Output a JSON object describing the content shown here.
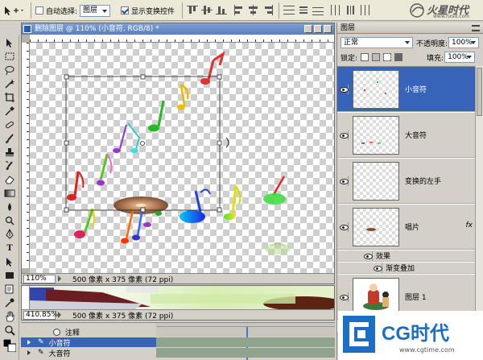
{
  "options_bar": {
    "auto_select_label": "自动选择:",
    "auto_select_value": "图层",
    "show_transform_label": "显示变换控件",
    "logo_brand": "火星时代",
    "logo_url": "www.hxsd.com"
  },
  "document": {
    "title": "删除图层 @ 110% (小音符, RGB/8) *",
    "zoom": "110%",
    "status": "500 像素 x 375 像素 (72 ppi)"
  },
  "document2": {
    "zoom": "410.85%",
    "status": "500 像素 x 375 像素 (72 ppi)"
  },
  "animation": {
    "rows": [
      {
        "label": "注释"
      },
      {
        "label": "小音符"
      },
      {
        "label": "大音符"
      }
    ]
  },
  "layers_panel": {
    "tab_label": "图层",
    "blend_mode": "正常",
    "opacity_label": "不透明度:",
    "opacity_value": "100%",
    "lock_label": "锁定:",
    "fill_label": "填充:",
    "fill_value": "100%",
    "layers": [
      {
        "name": "小音符"
      },
      {
        "name": "大音符"
      },
      {
        "name": "变换的左手"
      },
      {
        "name": "唱片",
        "fx": "fx"
      },
      {
        "name": "图层 1"
      }
    ],
    "effects_label": "效果",
    "effect_item": "渐变叠加"
  },
  "watermark": {
    "brand": "CG时代",
    "url": "www.cgtime.com"
  },
  "colors": {
    "selection": "#3764b8",
    "panel_bg": "#d4d0c8",
    "track": "#8fa38f"
  }
}
